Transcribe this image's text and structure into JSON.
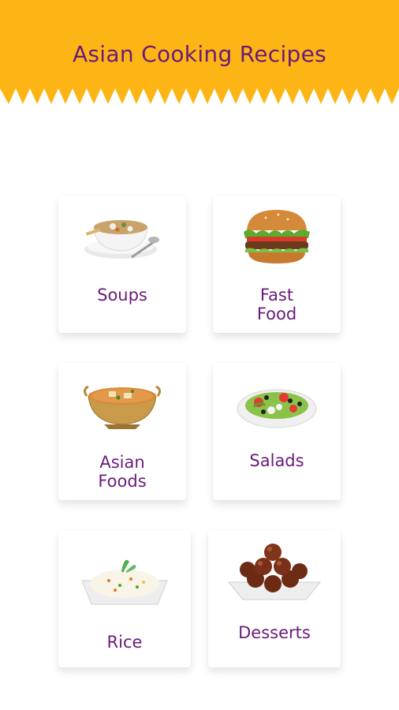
{
  "app": {
    "title": "Asian Cooking Recipes"
  },
  "categories": [
    {
      "label": "Soups",
      "icon": "soup-bowl-icon"
    },
    {
      "label": "Fast\nFood",
      "icon": "burger-icon"
    },
    {
      "label": "Asian\nFoods",
      "icon": "curry-bowl-icon"
    },
    {
      "label": "Salads",
      "icon": "salad-plate-icon"
    },
    {
      "label": "Rice",
      "icon": "rice-plate-icon"
    },
    {
      "label": "Desserts",
      "icon": "dessert-plate-icon"
    }
  ],
  "colors": {
    "header_bg": "#FDB515",
    "title_text": "#6A1B7A",
    "card_bg": "#FFFFFF"
  }
}
